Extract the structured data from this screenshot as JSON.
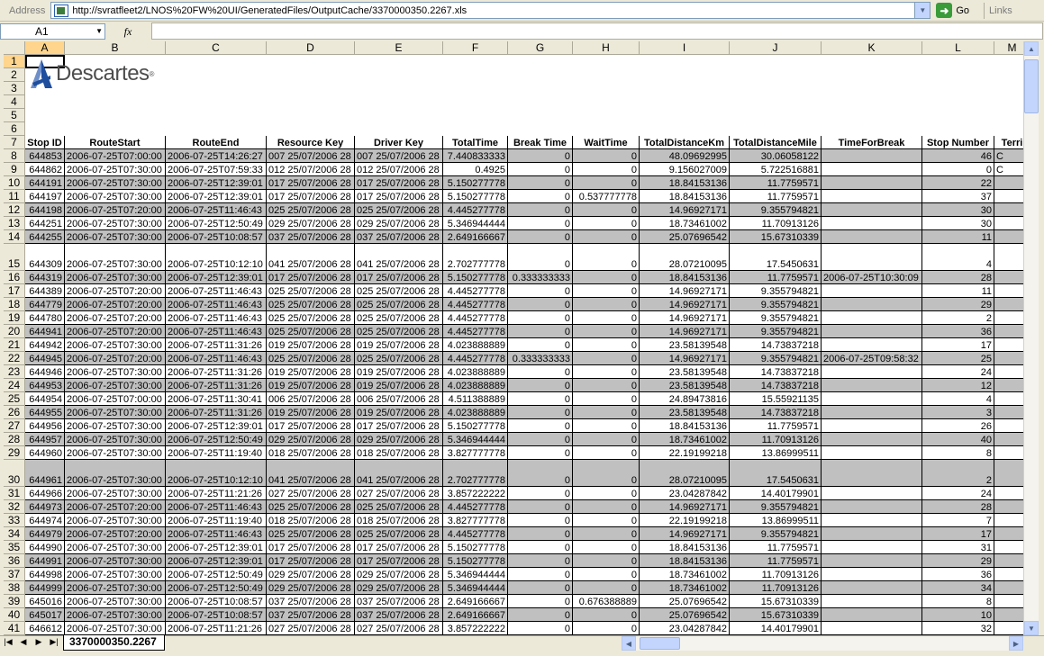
{
  "address_bar": {
    "label": "Address",
    "url": "http://svratfleet2/LNOS%20FW%20UI/GeneratedFiles/OutputCache/3370000350.2267.xls",
    "go_label": "Go",
    "links_label": "Links"
  },
  "formula_bar": {
    "name_box": "A1",
    "fx_label": "fx",
    "formula": ""
  },
  "logo": {
    "text": "Descartes",
    "mark": "®"
  },
  "columns": [
    "A",
    "B",
    "C",
    "D",
    "E",
    "F",
    "G",
    "H",
    "I",
    "J",
    "K",
    "L",
    "M"
  ],
  "active_column": "A",
  "active_row": "1",
  "blank_rows": [
    "1",
    "2",
    "3",
    "4",
    "5",
    "6"
  ],
  "header_row": {
    "row_number": "7",
    "cells": [
      "Stop ID",
      "RouteStart",
      "RouteEnd",
      "Resource Key",
      "Driver Key",
      "TotalTime",
      "Break Time",
      "WaitTime",
      "TotalDistanceKm",
      "TotalDistanceMile",
      "TimeForBreak",
      "Stop Number",
      "Terri"
    ]
  },
  "data_rows": [
    {
      "n": "8",
      "c": [
        "644853",
        "2006-07-25T07:00:00",
        "2006-07-25T14:26:27",
        "007 25/07/2006 28",
        "007 25/07/2006 28",
        "7.440833333",
        "0",
        "0",
        "48.09692995",
        "30.06058122",
        "",
        "46",
        "C"
      ]
    },
    {
      "n": "9",
      "c": [
        "644862",
        "2006-07-25T07:30:00",
        "2006-07-25T07:59:33",
        "012 25/07/2006 28",
        "012 25/07/2006 28",
        "0.4925",
        "0",
        "0",
        "9.156027009",
        "5.722516881",
        "",
        "0",
        "C"
      ]
    },
    {
      "n": "10",
      "c": [
        "644191",
        "2006-07-25T07:30:00",
        "2006-07-25T12:39:01",
        "017 25/07/2006 28",
        "017 25/07/2006 28",
        "5.150277778",
        "0",
        "0",
        "18.84153136",
        "11.7759571",
        "",
        "22",
        ""
      ]
    },
    {
      "n": "11",
      "c": [
        "644197",
        "2006-07-25T07:30:00",
        "2006-07-25T12:39:01",
        "017 25/07/2006 28",
        "017 25/07/2006 28",
        "5.150277778",
        "0",
        "0.537777778",
        "18.84153136",
        "11.7759571",
        "",
        "37",
        ""
      ]
    },
    {
      "n": "12",
      "c": [
        "644198",
        "2006-07-25T07:20:00",
        "2006-07-25T11:46:43",
        "025 25/07/2006 28",
        "025 25/07/2006 28",
        "4.445277778",
        "0",
        "0",
        "14.96927171",
        "9.355794821",
        "",
        "30",
        ""
      ]
    },
    {
      "n": "13",
      "c": [
        "644251",
        "2006-07-25T07:30:00",
        "2006-07-25T12:50:49",
        "029 25/07/2006 28",
        "029 25/07/2006 28",
        "5.346944444",
        "0",
        "0",
        "18.73461002",
        "11.70913126",
        "",
        "30",
        ""
      ]
    },
    {
      "n": "14",
      "c": [
        "644255",
        "2006-07-25T07:30:00",
        "2006-07-25T10:08:57",
        "037 25/07/2006 28",
        "037 25/07/2006 28",
        "2.649166667",
        "0",
        "0",
        "25.07696542",
        "15.67310339",
        "",
        "11",
        ""
      ]
    },
    {
      "n": "15",
      "c": [
        "644309",
        "2006-07-25T07:30:00",
        "2006-07-25T10:12:10",
        "041 25/07/2006 28",
        "041 25/07/2006 28",
        "2.702777778",
        "0",
        "0",
        "28.07210095",
        "17.5450631",
        "",
        "4",
        ""
      ]
    },
    {
      "n": "16",
      "c": [
        "644319",
        "2006-07-25T07:30:00",
        "2006-07-25T12:39:01",
        "017 25/07/2006 28",
        "017 25/07/2006 28",
        "5.150277778",
        "0.333333333",
        "0",
        "18.84153136",
        "11.7759571",
        "2006-07-25T10:30:09",
        "28",
        ""
      ]
    },
    {
      "n": "17",
      "c": [
        "644389",
        "2006-07-25T07:20:00",
        "2006-07-25T11:46:43",
        "025 25/07/2006 28",
        "025 25/07/2006 28",
        "4.445277778",
        "0",
        "0",
        "14.96927171",
        "9.355794821",
        "",
        "11",
        ""
      ]
    },
    {
      "n": "18",
      "c": [
        "644779",
        "2006-07-25T07:20:00",
        "2006-07-25T11:46:43",
        "025 25/07/2006 28",
        "025 25/07/2006 28",
        "4.445277778",
        "0",
        "0",
        "14.96927171",
        "9.355794821",
        "",
        "29",
        ""
      ]
    },
    {
      "n": "19",
      "c": [
        "644780",
        "2006-07-25T07:20:00",
        "2006-07-25T11:46:43",
        "025 25/07/2006 28",
        "025 25/07/2006 28",
        "4.445277778",
        "0",
        "0",
        "14.96927171",
        "9.355794821",
        "",
        "2",
        ""
      ]
    },
    {
      "n": "20",
      "c": [
        "644941",
        "2006-07-25T07:20:00",
        "2006-07-25T11:46:43",
        "025 25/07/2006 28",
        "025 25/07/2006 28",
        "4.445277778",
        "0",
        "0",
        "14.96927171",
        "9.355794821",
        "",
        "36",
        ""
      ]
    },
    {
      "n": "21",
      "c": [
        "644942",
        "2006-07-25T07:30:00",
        "2006-07-25T11:31:26",
        "019 25/07/2006 28",
        "019 25/07/2006 28",
        "4.023888889",
        "0",
        "0",
        "23.58139548",
        "14.73837218",
        "",
        "17",
        ""
      ]
    },
    {
      "n": "22",
      "c": [
        "644945",
        "2006-07-25T07:20:00",
        "2006-07-25T11:46:43",
        "025 25/07/2006 28",
        "025 25/07/2006 28",
        "4.445277778",
        "0.333333333",
        "0",
        "14.96927171",
        "9.355794821",
        "2006-07-25T09:58:32",
        "25",
        ""
      ]
    },
    {
      "n": "23",
      "c": [
        "644946",
        "2006-07-25T07:30:00",
        "2006-07-25T11:31:26",
        "019 25/07/2006 28",
        "019 25/07/2006 28",
        "4.023888889",
        "0",
        "0",
        "23.58139548",
        "14.73837218",
        "",
        "24",
        ""
      ]
    },
    {
      "n": "24",
      "c": [
        "644953",
        "2006-07-25T07:30:00",
        "2006-07-25T11:31:26",
        "019 25/07/2006 28",
        "019 25/07/2006 28",
        "4.023888889",
        "0",
        "0",
        "23.58139548",
        "14.73837218",
        "",
        "12",
        ""
      ]
    },
    {
      "n": "25",
      "c": [
        "644954",
        "2006-07-25T07:00:00",
        "2006-07-25T11:30:41",
        "006 25/07/2006 28",
        "006 25/07/2006 28",
        "4.511388889",
        "0",
        "0",
        "24.89473816",
        "15.55921135",
        "",
        "4",
        ""
      ]
    },
    {
      "n": "26",
      "c": [
        "644955",
        "2006-07-25T07:30:00",
        "2006-07-25T11:31:26",
        "019 25/07/2006 28",
        "019 25/07/2006 28",
        "4.023888889",
        "0",
        "0",
        "23.58139548",
        "14.73837218",
        "",
        "3",
        ""
      ]
    },
    {
      "n": "27",
      "c": [
        "644956",
        "2006-07-25T07:30:00",
        "2006-07-25T12:39:01",
        "017 25/07/2006 28",
        "017 25/07/2006 28",
        "5.150277778",
        "0",
        "0",
        "18.84153136",
        "11.7759571",
        "",
        "26",
        ""
      ]
    },
    {
      "n": "28",
      "c": [
        "644957",
        "2006-07-25T07:30:00",
        "2006-07-25T12:50:49",
        "029 25/07/2006 28",
        "029 25/07/2006 28",
        "5.346944444",
        "0",
        "0",
        "18.73461002",
        "11.70913126",
        "",
        "40",
        ""
      ]
    },
    {
      "n": "29",
      "c": [
        "644960",
        "2006-07-25T07:30:00",
        "2006-07-25T11:19:40",
        "018 25/07/2006 28",
        "018 25/07/2006 28",
        "3.827777778",
        "0",
        "0",
        "22.19199218",
        "13.86999511",
        "",
        "8",
        ""
      ]
    },
    {
      "n": "30",
      "c": [
        "644961",
        "2006-07-25T07:30:00",
        "2006-07-25T10:12:10",
        "041 25/07/2006 28",
        "041 25/07/2006 28",
        "2.702777778",
        "0",
        "0",
        "28.07210095",
        "17.5450631",
        "",
        "2",
        ""
      ]
    },
    {
      "n": "31",
      "c": [
        "644966",
        "2006-07-25T07:30:00",
        "2006-07-25T11:21:26",
        "027 25/07/2006 28",
        "027 25/07/2006 28",
        "3.857222222",
        "0",
        "0",
        "23.04287842",
        "14.40179901",
        "",
        "24",
        ""
      ]
    },
    {
      "n": "32",
      "c": [
        "644973",
        "2006-07-25T07:20:00",
        "2006-07-25T11:46:43",
        "025 25/07/2006 28",
        "025 25/07/2006 28",
        "4.445277778",
        "0",
        "0",
        "14.96927171",
        "9.355794821",
        "",
        "28",
        ""
      ]
    },
    {
      "n": "33",
      "c": [
        "644974",
        "2006-07-25T07:30:00",
        "2006-07-25T11:19:40",
        "018 25/07/2006 28",
        "018 25/07/2006 28",
        "3.827777778",
        "0",
        "0",
        "22.19199218",
        "13.86999511",
        "",
        "7",
        ""
      ]
    },
    {
      "n": "34",
      "c": [
        "644979",
        "2006-07-25T07:20:00",
        "2006-07-25T11:46:43",
        "025 25/07/2006 28",
        "025 25/07/2006 28",
        "4.445277778",
        "0",
        "0",
        "14.96927171",
        "9.355794821",
        "",
        "17",
        ""
      ]
    },
    {
      "n": "35",
      "c": [
        "644990",
        "2006-07-25T07:30:00",
        "2006-07-25T12:39:01",
        "017 25/07/2006 28",
        "017 25/07/2006 28",
        "5.150277778",
        "0",
        "0",
        "18.84153136",
        "11.7759571",
        "",
        "31",
        ""
      ]
    },
    {
      "n": "36",
      "c": [
        "644991",
        "2006-07-25T07:30:00",
        "2006-07-25T12:39:01",
        "017 25/07/2006 28",
        "017 25/07/2006 28",
        "5.150277778",
        "0",
        "0",
        "18.84153136",
        "11.7759571",
        "",
        "29",
        ""
      ]
    },
    {
      "n": "37",
      "c": [
        "644998",
        "2006-07-25T07:30:00",
        "2006-07-25T12:50:49",
        "029 25/07/2006 28",
        "029 25/07/2006 28",
        "5.346944444",
        "0",
        "0",
        "18.73461002",
        "11.70913126",
        "",
        "36",
        ""
      ]
    },
    {
      "n": "38",
      "c": [
        "644999",
        "2006-07-25T07:30:00",
        "2006-07-25T12:50:49",
        "029 25/07/2006 28",
        "029 25/07/2006 28",
        "5.346944444",
        "0",
        "0",
        "18.73461002",
        "11.70913126",
        "",
        "34",
        ""
      ]
    },
    {
      "n": "39",
      "c": [
        "645016",
        "2006-07-25T07:30:00",
        "2006-07-25T10:08:57",
        "037 25/07/2006 28",
        "037 25/07/2006 28",
        "2.649166667",
        "0",
        "0.676388889",
        "25.07696542",
        "15.67310339",
        "",
        "8",
        ""
      ]
    },
    {
      "n": "40",
      "c": [
        "645017",
        "2006-07-25T07:30:00",
        "2006-07-25T10:08:57",
        "037 25/07/2006 28",
        "037 25/07/2006 28",
        "2.649166667",
        "0",
        "0",
        "25.07696542",
        "15.67310339",
        "",
        "10",
        ""
      ]
    },
    {
      "n": "41",
      "c": [
        "646612",
        "2006-07-25T07:30:00",
        "2006-07-25T11:21:26",
        "027 25/07/2006 28",
        "027 25/07/2006 28",
        "3.857222222",
        "0",
        "0",
        "23.04287842",
        "14.40179901",
        "",
        "32",
        ""
      ]
    }
  ],
  "sheet_tab": {
    "label": "3370000350.2267"
  },
  "colors": {
    "grey_row": "#c0c0c0",
    "header_bg": "#ece9d8",
    "active_header": "#ffd58d",
    "logo_blue": "#1f4e9e"
  }
}
